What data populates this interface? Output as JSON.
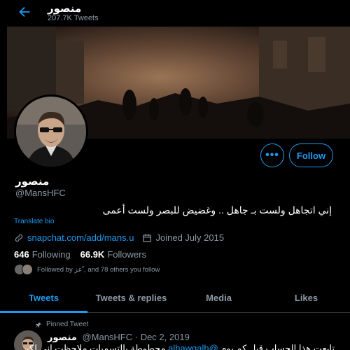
{
  "header": {
    "name": "منصور",
    "tweet_count": "207.7K Tweets"
  },
  "profile": {
    "name": "منصور",
    "handle": "@MansHFC",
    "bio": "إني اتجاهل ولست بـ جاهل .. وغضيض للبصر ولست أعمى",
    "translate": "Translate bio",
    "link": "snapchat.com/add/mans.u",
    "joined": "Joined July 2015",
    "following_count": "646",
    "following_label": "Following",
    "followers_count": "66.9K",
    "followers_label": "Followers",
    "followed_by": "Followed by عز ّ, and 78 others you follow"
  },
  "buttons": {
    "more": "•••",
    "follow": "Follow"
  },
  "tabs": [
    {
      "label": "Tweets",
      "active": true
    },
    {
      "label": "Tweets & replies",
      "active": false
    },
    {
      "label": "Media",
      "active": false
    },
    {
      "label": "Likes",
      "active": false
    }
  ],
  "tweet": {
    "pinned_label": "Pinned Tweet",
    "name": "منصور",
    "handle_date": "@MansHFC · Dec 2, 2019",
    "text_prefix": "تابعت هذا الحساب قبل كم يوم ",
    "mention": "@alhawgalh",
    "text_suffix": " محطوطة بالتسميات ملاحظت إني لكن"
  },
  "colors": {
    "accent": "#1d9bf0",
    "background": "#000000",
    "muted": "#8b98a5"
  },
  "icons": {
    "back": "arrow-left-icon",
    "link": "link-icon",
    "calendar": "calendar-icon",
    "pin": "pin-icon"
  }
}
